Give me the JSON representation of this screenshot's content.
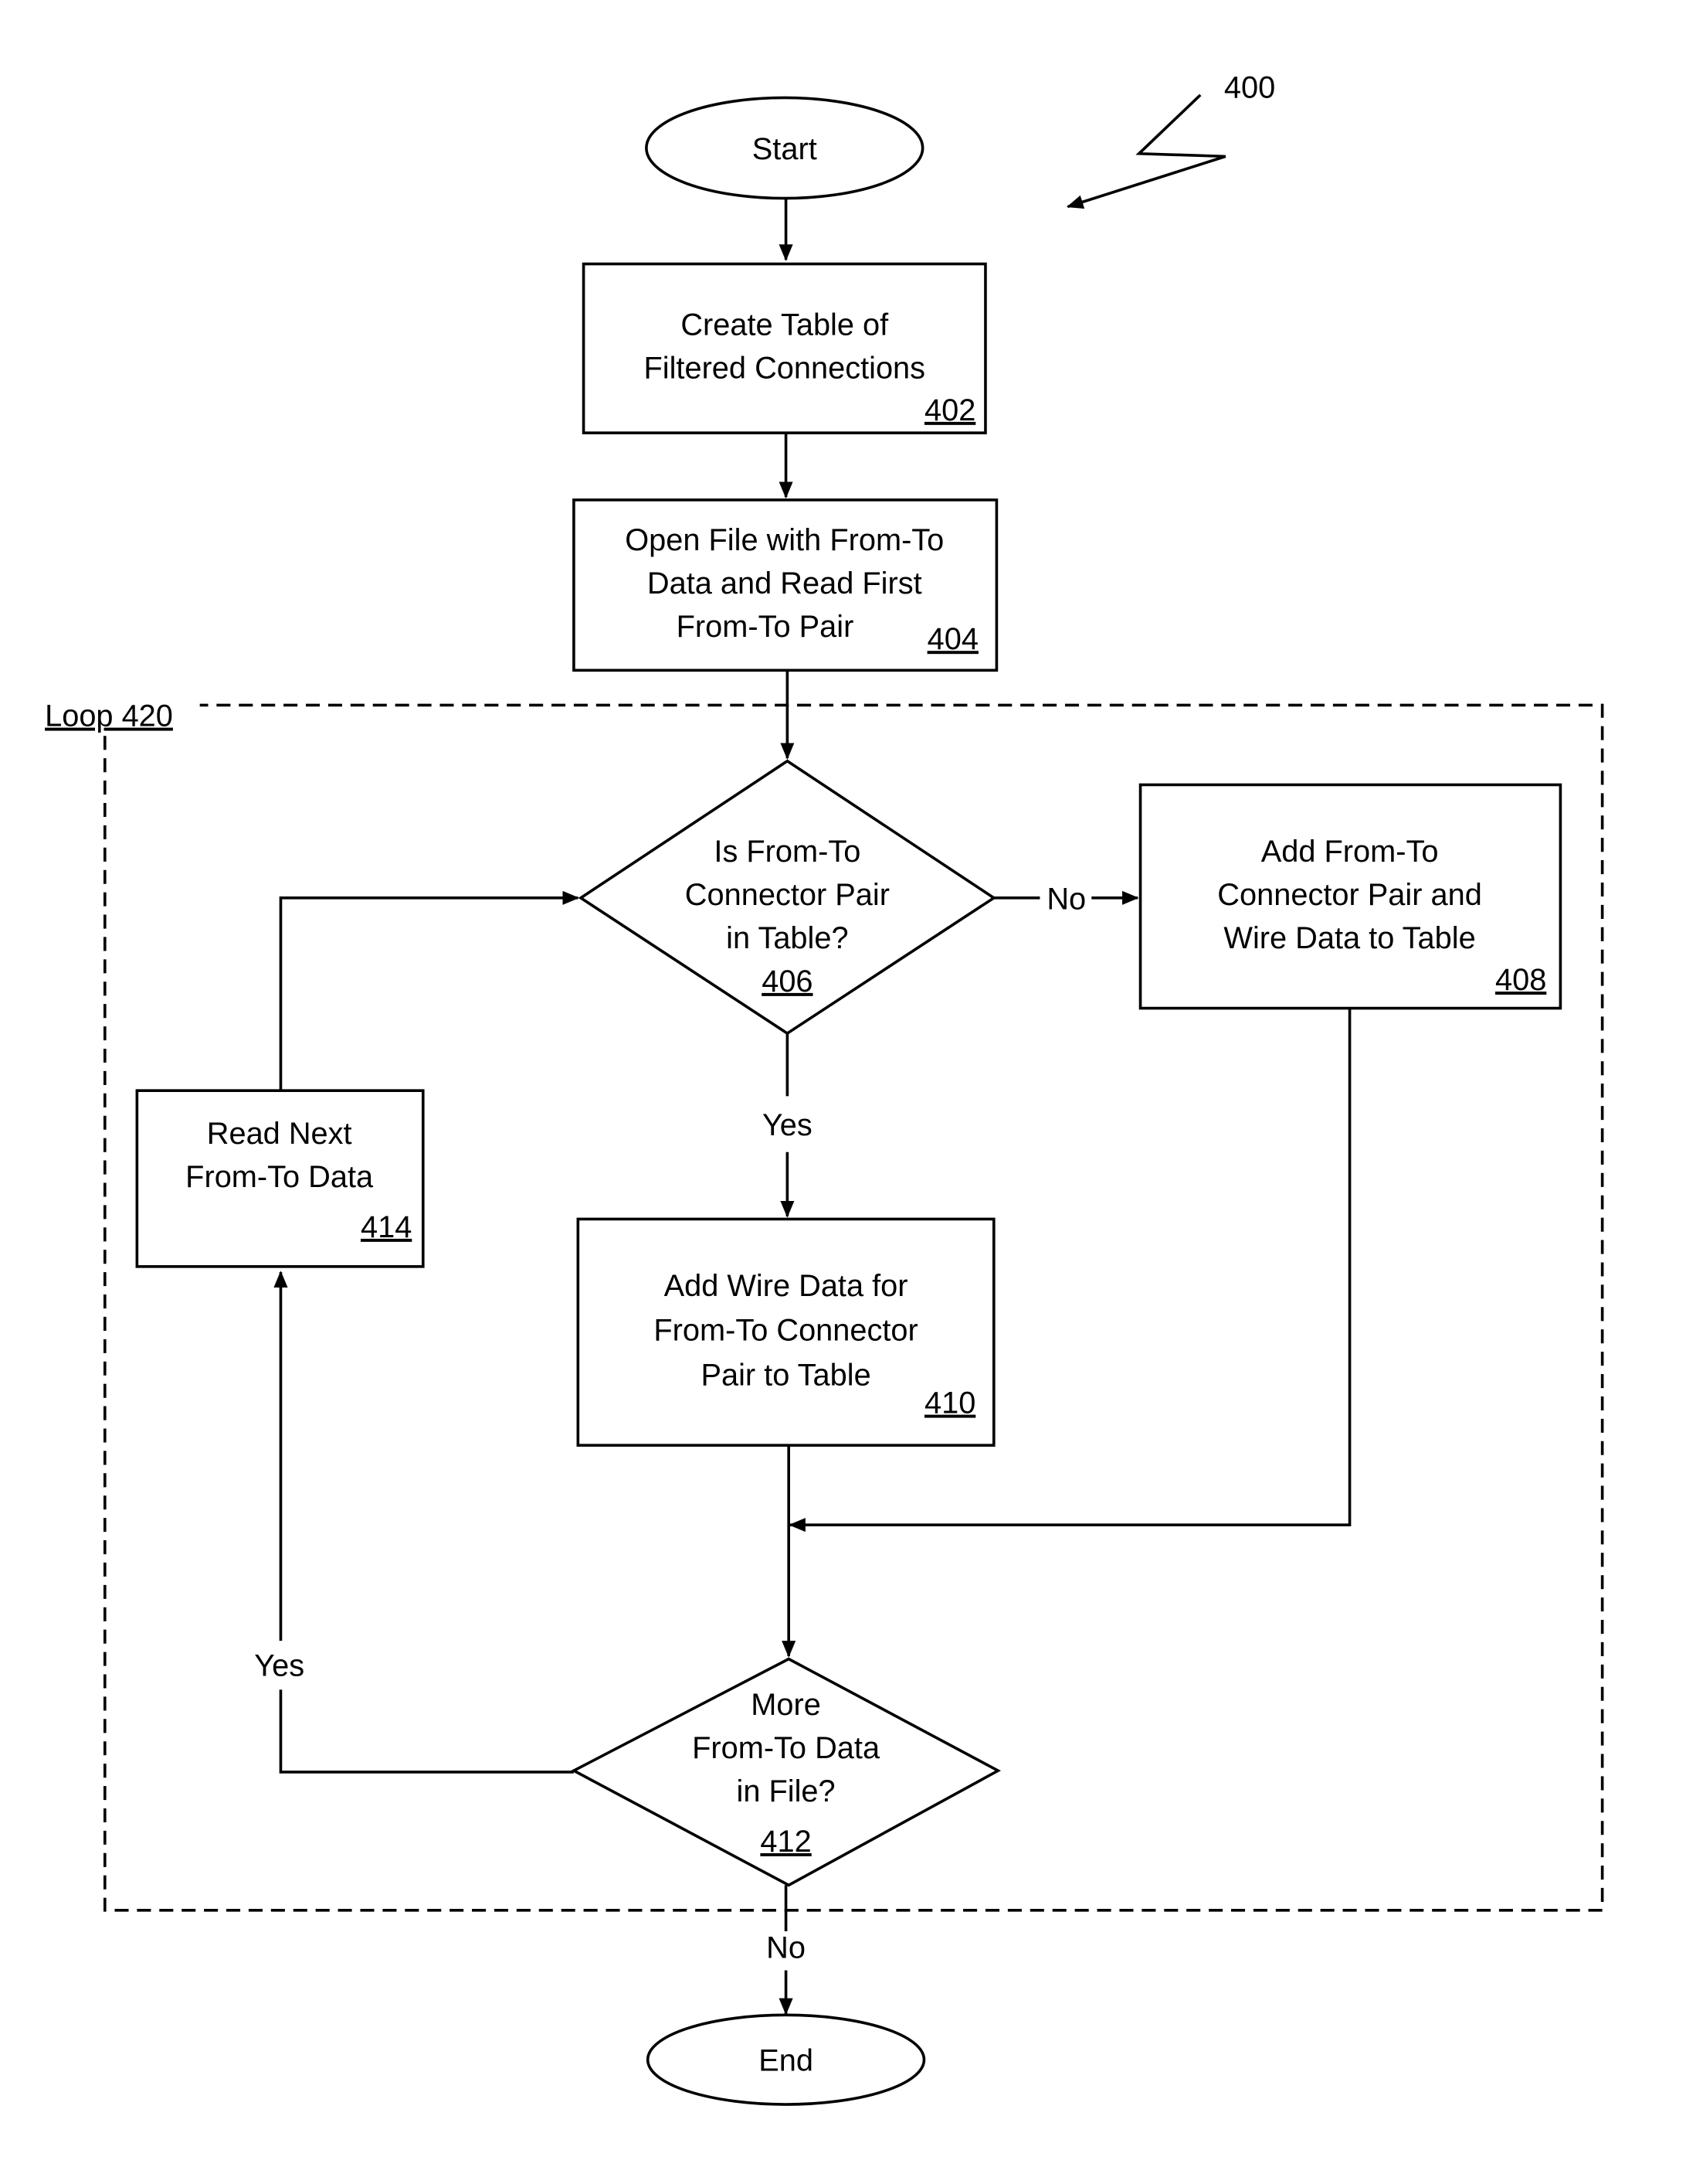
{
  "figure": {
    "reference_number": "400",
    "loop_label": "Loop 420"
  },
  "nodes": {
    "start": {
      "label": "Start"
    },
    "n402": {
      "lines": [
        "Create Table of",
        "Filtered Connections"
      ],
      "number": "402"
    },
    "n404": {
      "lines": [
        "Open File with From-To",
        "Data and Read First",
        "From-To Pair"
      ],
      "number": "404"
    },
    "n406": {
      "lines": [
        "Is From-To",
        "Connector Pair",
        "in Table?"
      ],
      "number": "406"
    },
    "n408": {
      "lines": [
        "Add From-To",
        "Connector Pair and",
        "Wire Data to Table"
      ],
      "number": "408"
    },
    "n410": {
      "lines": [
        "Add Wire Data for",
        "From-To Connector",
        "Pair to Table"
      ],
      "number": "410"
    },
    "n412": {
      "lines": [
        "More",
        "From-To Data",
        "in File?"
      ],
      "number": "412"
    },
    "n414": {
      "lines": [
        "Read Next",
        "From-To Data"
      ],
      "number": "414"
    },
    "end": {
      "label": "End"
    }
  },
  "edge_labels": {
    "n406_no": "No",
    "n406_yes": "Yes",
    "n412_yes": "Yes",
    "n412_no": "No"
  }
}
